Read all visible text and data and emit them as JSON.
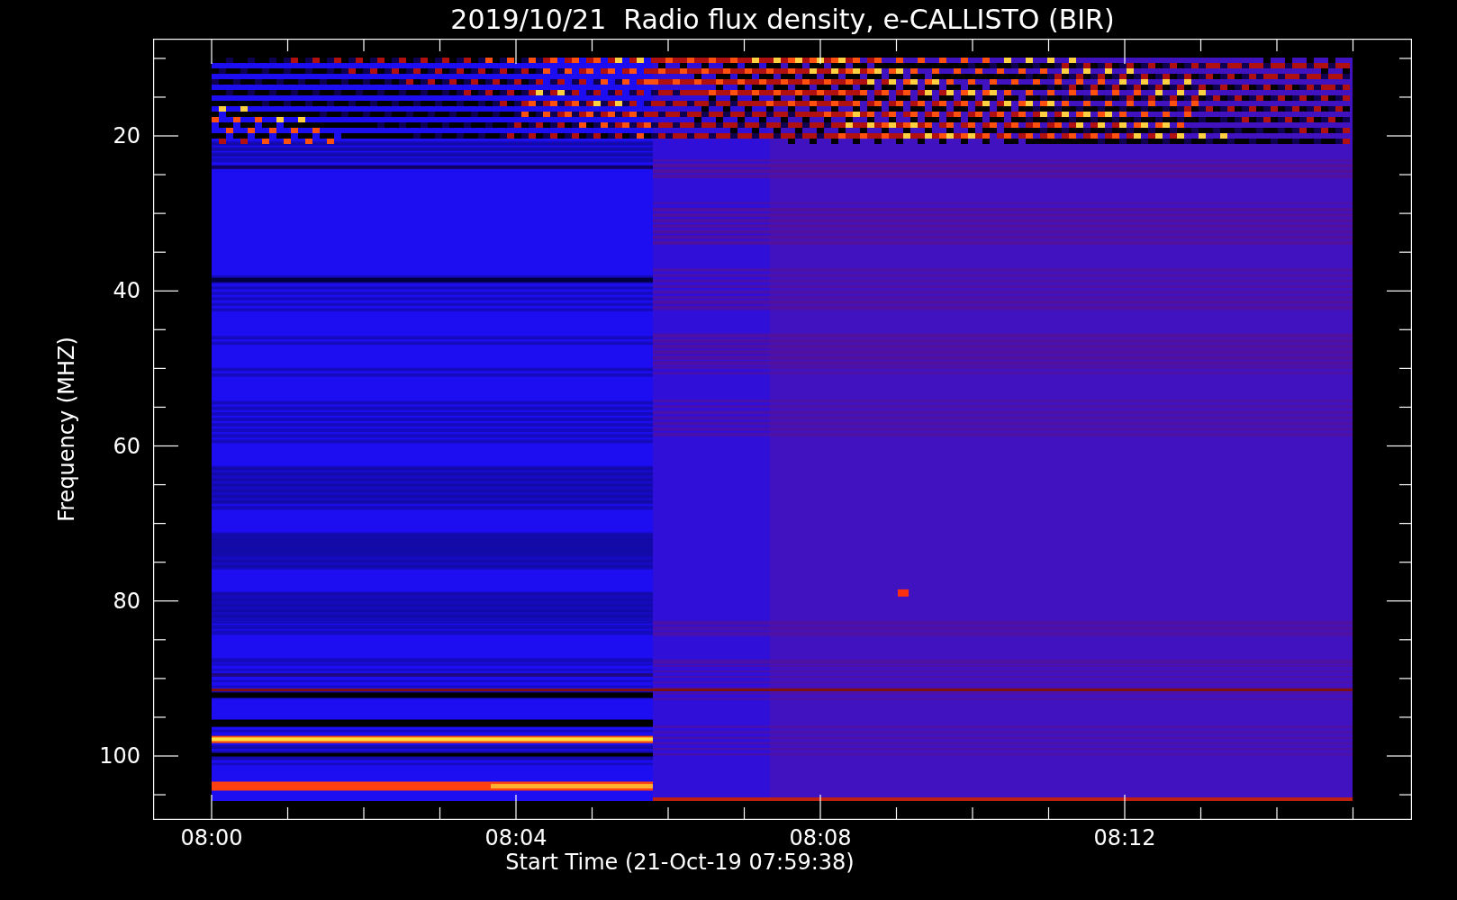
{
  "title": "2019/10/21  Radio flux density, e-CALLISTO (BIR)",
  "y_axis": {
    "label": "Frequency (MHZ)",
    "ticks": [
      "20",
      "40",
      "60",
      "80",
      "100"
    ]
  },
  "x_axis": {
    "label": "Start Time (21-Oct-19 07:59:38)",
    "ticks": [
      "08:00",
      "08:04",
      "08:08",
      "08:12"
    ]
  }
}
